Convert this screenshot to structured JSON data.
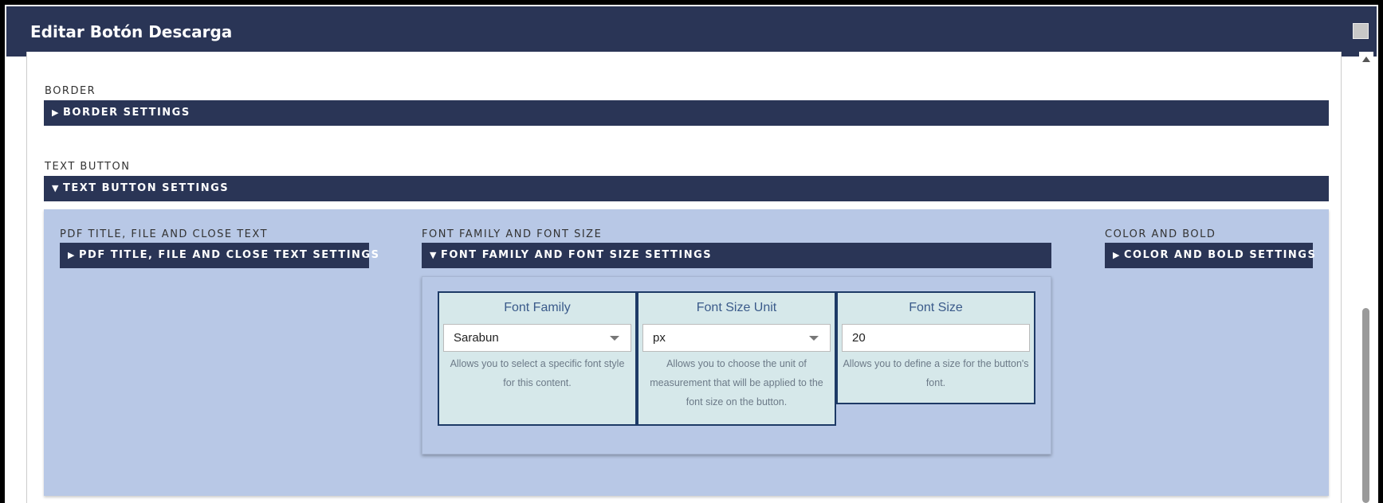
{
  "window": {
    "title": "Editar Botón Descarga"
  },
  "sections": {
    "border": {
      "label": "BORDER",
      "header": "BORDER SETTINGS",
      "arrow": "▶"
    },
    "text_button": {
      "label": "TEXT BUTTON",
      "header": "TEXT BUTTON SETTINGS",
      "arrow": "▼"
    }
  },
  "subsections": {
    "pdf": {
      "label": "PDF TITLE, FILE AND CLOSE TEXT",
      "header": "PDF TITLE, FILE AND CLOSE TEXT SETTINGS",
      "arrow": "▶"
    },
    "font": {
      "label": "FONT FAMILY AND FONT SIZE",
      "header": "FONT FAMILY AND FONT SIZE SETTINGS",
      "arrow": "▼"
    },
    "color": {
      "label": "COLOR AND BOLD",
      "header": "COLOR AND BOLD SETTINGS",
      "arrow": "▶"
    }
  },
  "fields": {
    "font_family": {
      "title": "Font Family",
      "value": "Sarabun",
      "help": "Allows you to select a specific font style for this content."
    },
    "font_size_unit": {
      "title": "Font Size Unit",
      "value": "px",
      "help": "Allows you to choose the unit of measurement that will be applied to the font size on the button."
    },
    "font_size": {
      "title": "Font Size",
      "value": "20",
      "help": "Allows you to define a size for the button's font."
    }
  }
}
